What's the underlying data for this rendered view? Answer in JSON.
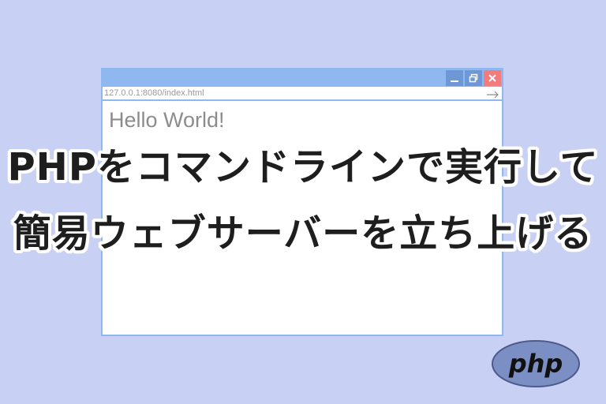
{
  "browser": {
    "url": "127.0.0.1:8080/index.html",
    "page_text": "Hello World!",
    "controls": {
      "minimize_icon": "minimize-icon",
      "maximize_icon": "restore-icon",
      "close_icon": "close-icon",
      "go_icon": "arrow-right-icon"
    }
  },
  "headline": {
    "line1": "PHPをコマンドラインで実行して",
    "line2": "簡易ウェブサーバーを立ち上げる"
  },
  "logo": {
    "text": "php"
  },
  "colors": {
    "background": "#c8d0f4",
    "window_frame": "#8fb8f0",
    "close_button": "#f47b7b",
    "logo_fill": "#7c8fc4"
  }
}
